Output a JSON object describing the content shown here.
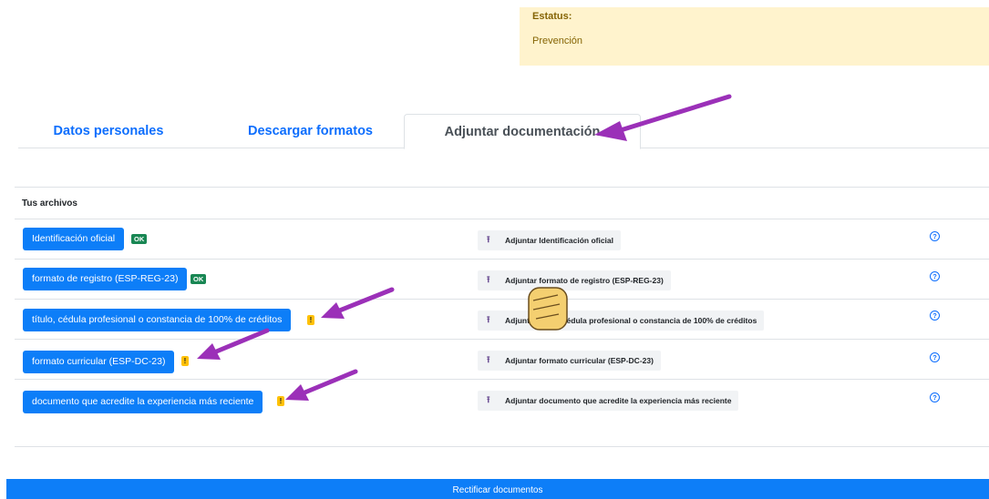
{
  "status": {
    "label": "Estatus:",
    "value": "Prevención"
  },
  "tabs": [
    {
      "label": "Datos personales"
    },
    {
      "label": "Descargar formatos"
    },
    {
      "label": "Adjuntar documentación"
    }
  ],
  "files": {
    "title": "Tus archivos",
    "rows": [
      {
        "name": "Identificación oficial",
        "badge": "OK",
        "badge_type": "ok",
        "attach_label": "Adjuntar Identificación oficial",
        "help": "?"
      },
      {
        "name": "formato de registro (ESP-REG-23)",
        "badge": "OK",
        "badge_type": "ok",
        "attach_label": "Adjuntar formato de registro (ESP-REG-23)",
        "help": "?"
      },
      {
        "name": "título, cédula profesional o constancia de 100% de créditos",
        "badge": "!",
        "badge_type": "warning",
        "attach_label": "Adjuntar título, cédula profesional o constancia de 100% de créditos",
        "help": "?"
      },
      {
        "name": "formato curricular (ESP-DC-23)",
        "badge": "!",
        "badge_type": "warning",
        "attach_label": "Adjuntar formato curricular (ESP-DC-23)",
        "help": "?"
      },
      {
        "name": "documento que acredite la experiencia más reciente",
        "badge": "!",
        "badge_type": "warning",
        "attach_label": "Adjuntar documento que acredite la experiencia más reciente",
        "help": "?"
      }
    ]
  },
  "submit_label": "Rectificar documentos",
  "icons": {
    "attach": "upload-icon",
    "help": "question-circle-icon",
    "pointer": "hand-pointer-icon",
    "annotation": "arrow-annotation"
  },
  "colors": {
    "primary": "#0d7ef8",
    "ok": "#198754",
    "warning": "#ffc107",
    "status_bg": "#fff3cd",
    "annotation": "#9b30b8"
  }
}
